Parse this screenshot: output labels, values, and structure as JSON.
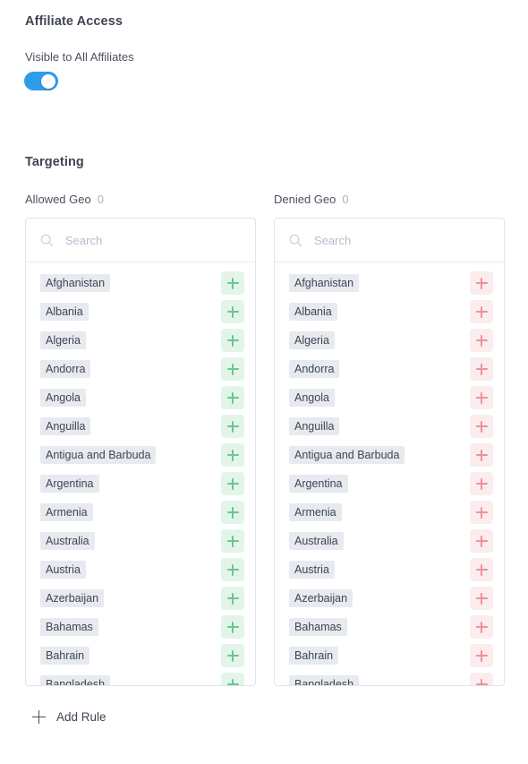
{
  "affiliate_access": {
    "title": "Affiliate Access",
    "visibility_label": "Visible to All Affiliates",
    "toggle_state": "on"
  },
  "targeting": {
    "title": "Targeting",
    "allowed": {
      "label": "Allowed Geo",
      "count": "0",
      "search_placeholder": "Search",
      "search_value": "",
      "action_icon": "plus-icon",
      "accent_color": "#6ac694",
      "accent_bg": "#e3f5e9"
    },
    "denied": {
      "label": "Denied Geo",
      "count": "0",
      "search_placeholder": "Search",
      "search_value": "",
      "action_icon": "plus-icon",
      "accent_color": "#ef9099",
      "accent_bg": "#fbecee"
    },
    "countries": [
      "Afghanistan",
      "Albania",
      "Algeria",
      "Andorra",
      "Angola",
      "Anguilla",
      "Antigua and Barbuda",
      "Argentina",
      "Armenia",
      "Australia",
      "Austria",
      "Azerbaijan",
      "Bahamas",
      "Bahrain",
      "Bangladesh"
    ]
  },
  "footer": {
    "add_rule_label": "Add Rule",
    "add_rule_icon": "plus-icon"
  },
  "colors": {
    "toggle_on": "#2f9cea",
    "heading": "#3f4551",
    "muted": "#a8b3c6",
    "panel_border": "#dfe4ed",
    "pill_bg": "#e7eaef"
  }
}
